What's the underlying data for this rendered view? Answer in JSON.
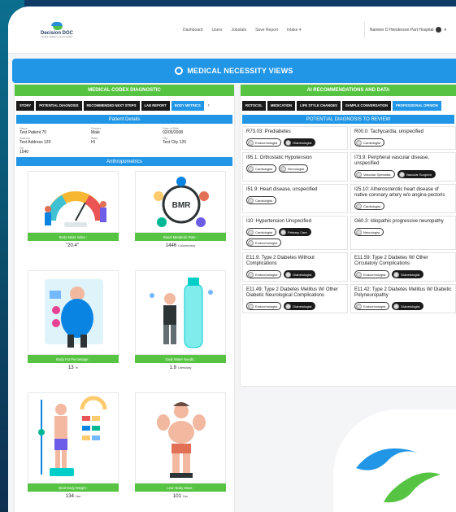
{
  "header": {
    "brand": "Decision DOC",
    "brand_sub": "Medical Intelligence and Innovation",
    "nav": [
      "Dashboard",
      "Users",
      "Jobstats",
      "Save Report",
      "Intake ▾"
    ],
    "user": "Nameer D Henderson Part Hospital"
  },
  "banner": {
    "title": "MEDICAL NECESSITY VIEWS"
  },
  "left": {
    "title": "MEDICAL CODEX DIAGNOSTIC",
    "tabs": [
      "STORY",
      "POTENTIAL DIAGNOSIS",
      "RECOMMENDED NEXT STEPS",
      "LAB REPORT",
      "BODY METRICS"
    ],
    "patient_details_title": "Patient Details",
    "patient": [
      {
        "label": "Name",
        "value": "Test Patient 70"
      },
      {
        "label": "Gender",
        "value": "Male"
      },
      {
        "label": "Date of Birth",
        "value": "02/05/2008"
      },
      {
        "label": "Address",
        "value": "Test Address 120"
      },
      {
        "label": "State",
        "value": "HI"
      },
      {
        "label": "City",
        "value": "Test City 120"
      },
      {
        "label": "Zip",
        "value": "1540"
      }
    ],
    "anthro_title": "Anthropometrics",
    "metrics": [
      {
        "label": "Body Mass Index :",
        "value": "\"20.4\"",
        "unit": ""
      },
      {
        "label": "Basal Metabolic Rate :",
        "value": "1446",
        "unit": "Calories/day"
      },
      {
        "label": "Body Fat Percentage :",
        "value": "13",
        "unit": "%"
      },
      {
        "label": "Daily Water Needs :",
        "value": "1.8",
        "unit": "Liters/day"
      },
      {
        "label": "Ideal Body Weight :",
        "value": "134",
        "unit": "Lbs"
      },
      {
        "label": "Lean Body Mass :",
        "value": "101",
        "unit": "Lbs"
      }
    ]
  },
  "right": {
    "title": "AI RECOMMENDATIONS AND DATA",
    "tabs": [
      "ROTOCOL",
      "MEDICATION",
      "LIFE STYLE CHANGES",
      "SAMPLE CONVERSATION",
      "PROFESSIONAL OPINION"
    ],
    "review_title": "POTENTIAL DIAGNOSIS TO REVIEW",
    "diagnoses": [
      {
        "title": "R73.03: Prediabetes",
        "badges": [
          "Endocrinologist",
          "Diabetologist"
        ]
      },
      {
        "title": "R00.0: Tachycardia, unspecified",
        "badges": [
          "Cardiologist"
        ]
      },
      {
        "title": "I95.1: Orthostatic Hypotension",
        "badges": [
          "Cardiologist",
          "Neurologist"
        ]
      },
      {
        "title": "I73.9: Peripheral vascular disease, unspecified",
        "badges": [
          "Vascular Specialist",
          "Vascular Surgeon"
        ]
      },
      {
        "title": "I51.9: Heart disease, unspecified",
        "badges": [
          "Cardiologist"
        ]
      },
      {
        "title": "I25.10: Atherosclerotic heart disease of native coronary artery w/o angina pectoris",
        "badges": [
          "Cardiologist"
        ]
      },
      {
        "title": "I10: Hypertension Unspecified",
        "badges": [
          "Cardiologist",
          "Primary Care",
          "Endocrinologist"
        ]
      },
      {
        "title": "G60.3: Idiopathic progressive neuropathy",
        "badges": [
          "Neurologist"
        ]
      },
      {
        "title": "E11.9: Type 2 Diabetes Without Complications",
        "badges": [
          "Endocrinologist",
          "Diabetologist"
        ]
      },
      {
        "title": "E11.59: Type 2 Diabetes W/ Other Circulatory Complications",
        "badges": [
          "Endocrinologist",
          "Diabetologist"
        ]
      },
      {
        "title": "E11.49: Type 2 Diabetes Mellitus W/ Other Diabetic Neurological Complications",
        "badges": [
          "Endocrinologist",
          "Diabetologist"
        ]
      },
      {
        "title": "E11.42: Type 2 Diabetes Mellitus W/ Diabetic Polyneuropathy",
        "badges": [
          "Endocrinologist",
          "Diabetologist"
        ]
      }
    ]
  },
  "colors": {
    "green": "#56c442",
    "blue": "#2196e6",
    "dark": "#1a1a1a"
  }
}
